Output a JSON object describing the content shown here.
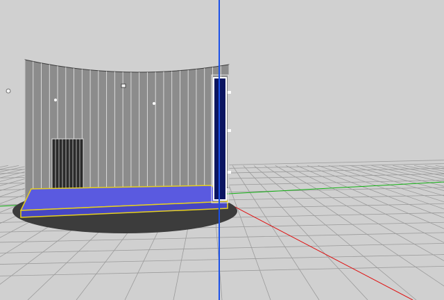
{
  "viewport": {
    "background_color": "#d0d0d0",
    "grid_color": "#9a9a9a",
    "axis_x_color": "#e01010",
    "axis_y_color": "#1a50e8",
    "axis_z_color": "#10b010"
  },
  "scene": {
    "wall_color": "#8c8c8c",
    "wall_stripe_color": "#f2f2f2",
    "floor_color": "#5a5ae0",
    "floor_outline_color": "#e6d020",
    "shadow_color": "#3c3c3c",
    "door_color": "#0a1460",
    "icons": [
      "gizmo-marker-icon",
      "camera-marker-icon",
      "light-marker-icon",
      "anchor-marker-icon",
      "handle-marker-icon"
    ]
  }
}
